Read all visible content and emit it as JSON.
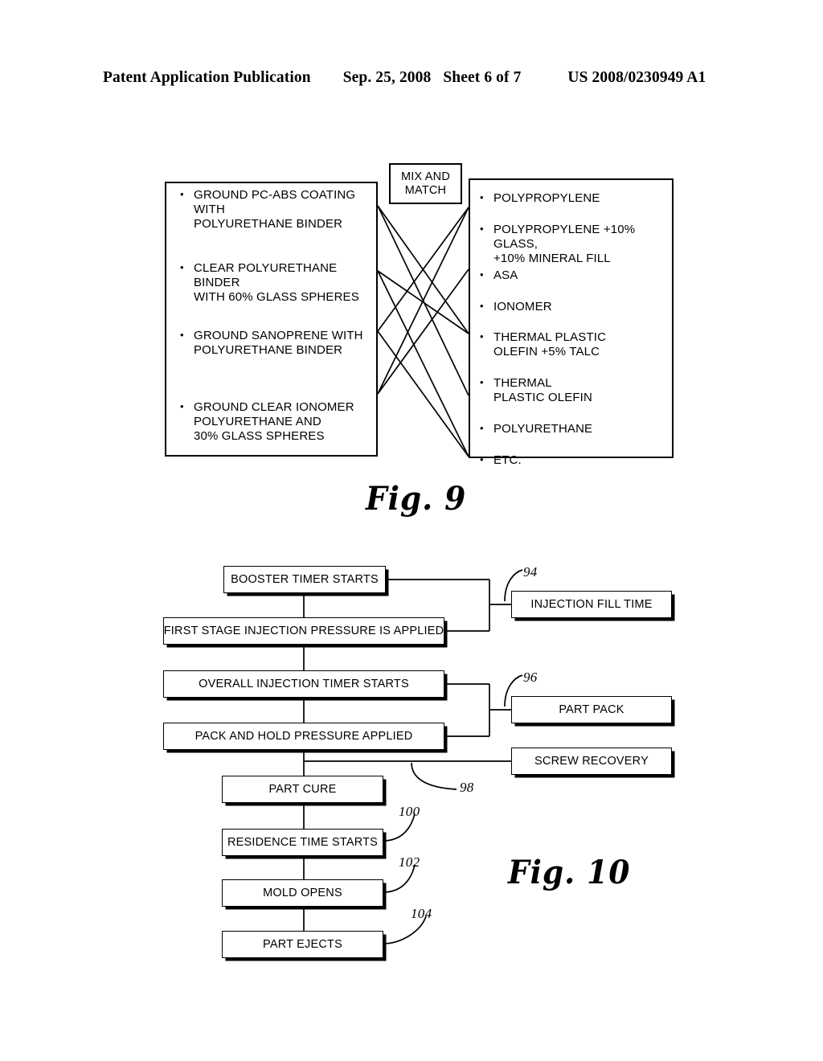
{
  "header": {
    "publication": "Patent Application Publication",
    "date": "Sep. 25, 2008",
    "sheet": "Sheet 6 of 7",
    "patent_number": "US 2008/0230949 A1"
  },
  "fig9": {
    "caption": "Fig. 9",
    "mix_and_match": {
      "line1": "MIX AND",
      "line2": "MATCH"
    },
    "left_items": [
      "GROUND PC-ABS COATING WITH\nPOLYURETHANE BINDER",
      "CLEAR POLYURETHANE BINDER\nWITH 60% GLASS SPHERES",
      "GROUND SANOPRENE WITH\nPOLYURETHANE BINDER",
      "GROUND CLEAR IONOMER\nPOLYURETHANE AND\n30% GLASS SPHERES"
    ],
    "right_items": [
      "POLYPROPYLENE",
      "POLYPROPYLENE +10% GLASS,\n+10% MINERAL FILL",
      "ASA",
      "IONOMER",
      "THERMAL PLASTIC\nOLEFIN +5% TALC",
      "THERMAL\nPLASTIC OLEFIN",
      "POLYURETHANE",
      "ETC."
    ]
  },
  "fig10": {
    "caption": "Fig. 10",
    "boxes": {
      "booster_timer": "BOOSTER TIMER STARTS",
      "first_stage": "FIRST STAGE INJECTION PRESSURE IS APPLIED",
      "overall_timer": "OVERALL INJECTION TIMER STARTS",
      "pack_and_hold": "PACK AND HOLD PRESSURE APPLIED",
      "part_cure": "PART CURE",
      "residence_time": "RESIDENCE TIME STARTS",
      "mold_opens": "MOLD OPENS",
      "part_ejects": "PART EJECTS",
      "injection_fill_time": "INJECTION FILL TIME",
      "part_pack": "PART PACK",
      "screw_recovery": "SCREW RECOVERY"
    },
    "callouts": {
      "injection_fill_time": "94",
      "part_pack": "96",
      "screw_recovery": "98",
      "residence_time": "100",
      "mold_opens": "102",
      "part_ejects": "104"
    }
  },
  "colors": {
    "ink": "#000000",
    "paper": "#ffffff"
  }
}
